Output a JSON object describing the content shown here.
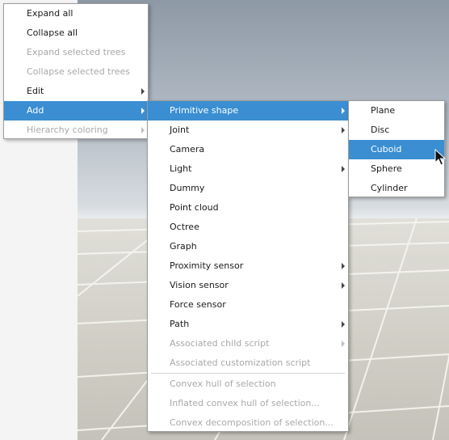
{
  "context_menu": {
    "items": [
      {
        "label": "Expand all",
        "enabled": true,
        "submenu": false
      },
      {
        "label": "Collapse all",
        "enabled": true,
        "submenu": false
      },
      {
        "label": "Expand selected trees",
        "enabled": false,
        "submenu": false
      },
      {
        "label": "Collapse selected trees",
        "enabled": false,
        "submenu": false
      },
      {
        "label": "Edit",
        "enabled": true,
        "submenu": true
      },
      {
        "label": "Add",
        "enabled": true,
        "submenu": true,
        "highlighted": true
      },
      {
        "label": "Hierarchy coloring",
        "enabled": false,
        "submenu": true
      }
    ]
  },
  "add_menu": {
    "items": [
      {
        "label": "Primitive shape",
        "enabled": true,
        "submenu": true,
        "highlighted": true
      },
      {
        "label": "Joint",
        "enabled": true,
        "submenu": true
      },
      {
        "label": "Camera",
        "enabled": true,
        "submenu": false
      },
      {
        "label": "Light",
        "enabled": true,
        "submenu": true
      },
      {
        "label": "Dummy",
        "enabled": true,
        "submenu": false
      },
      {
        "label": "Point cloud",
        "enabled": true,
        "submenu": false
      },
      {
        "label": "Octree",
        "enabled": true,
        "submenu": false
      },
      {
        "label": "Graph",
        "enabled": true,
        "submenu": false
      },
      {
        "label": "Proximity sensor",
        "enabled": true,
        "submenu": true
      },
      {
        "label": "Vision sensor",
        "enabled": true,
        "submenu": true
      },
      {
        "label": "Force sensor",
        "enabled": true,
        "submenu": false
      },
      {
        "label": "Path",
        "enabled": true,
        "submenu": true
      },
      {
        "label": "Associated child script",
        "enabled": false,
        "submenu": true
      },
      {
        "label": "Associated customization script",
        "enabled": false,
        "submenu": false
      },
      {
        "label": "Convex hull of selection",
        "enabled": false,
        "submenu": false
      },
      {
        "label": "Inflated convex hull of selection...",
        "enabled": false,
        "submenu": false
      },
      {
        "label": "Convex decomposition of selection...",
        "enabled": false,
        "submenu": false
      }
    ]
  },
  "primitive_menu": {
    "items": [
      {
        "label": "Plane",
        "enabled": true,
        "submenu": false
      },
      {
        "label": "Disc",
        "enabled": true,
        "submenu": false
      },
      {
        "label": "Cuboid",
        "enabled": true,
        "submenu": false,
        "highlighted": true
      },
      {
        "label": "Sphere",
        "enabled": true,
        "submenu": false
      },
      {
        "label": "Cylinder",
        "enabled": true,
        "submenu": false
      }
    ]
  },
  "icons": {
    "submenu_arrow": "chevron-right-icon",
    "pointer": "mouse-pointer-icon"
  },
  "colors": {
    "highlight": "#3a8ed1",
    "disabled_text": "#a8a8a8"
  }
}
